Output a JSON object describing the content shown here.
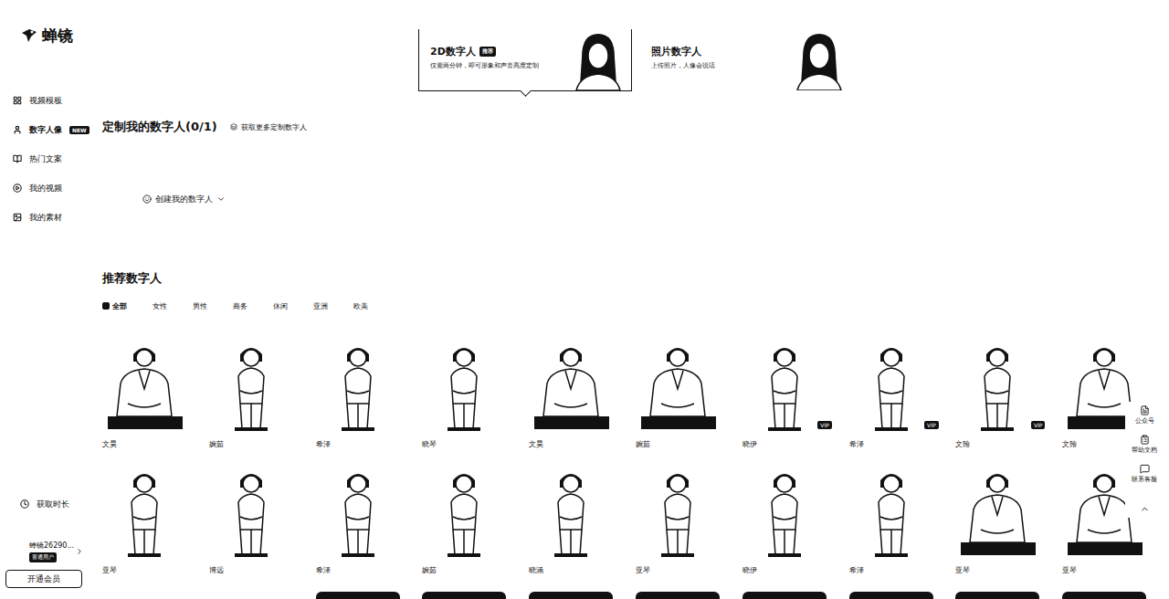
{
  "logo": {
    "text": "蝉镜"
  },
  "sidebar": {
    "items": [
      {
        "label": "视频模板",
        "selected": false,
        "badge": ""
      },
      {
        "label": "数字人像",
        "selected": true,
        "badge": "NEW"
      },
      {
        "label": "热门文案",
        "selected": false,
        "badge": ""
      },
      {
        "label": "我的视频",
        "selected": false,
        "badge": ""
      },
      {
        "label": "我的素材",
        "selected": false,
        "badge": ""
      }
    ],
    "get_time": "获取时长",
    "user": "蝉镜26290...",
    "user_tag": "普通用户",
    "button": "开通会员"
  },
  "mode_cards": [
    {
      "title": "2D数字人",
      "badge": "推荐",
      "subtitle": "仅需两分钟，即可形象和声音高度定制",
      "selected": true
    },
    {
      "title": "照片数字人",
      "badge": "",
      "subtitle": "上传照片，人像会说话",
      "selected": false
    }
  ],
  "custom": {
    "title": "定制我的数字人(0/1)",
    "more": "获取更多定制数字人",
    "create": "创建我的数字人"
  },
  "recommended": {
    "title": "推荐数字人",
    "filters": [
      {
        "label": "全部",
        "selected": true
      },
      {
        "label": "女性",
        "selected": false
      },
      {
        "label": "男性",
        "selected": false
      },
      {
        "label": "商务",
        "selected": false
      },
      {
        "label": "休闲",
        "selected": false
      },
      {
        "label": "亚洲",
        "selected": false
      },
      {
        "label": "欧美",
        "selected": false
      }
    ],
    "vip_badge": "VIP",
    "avatars": [
      {
        "name": "文昊",
        "vip": false,
        "kind": "sitting"
      },
      {
        "name": "婉茹",
        "vip": false,
        "kind": "standing"
      },
      {
        "name": "希泽",
        "vip": false,
        "kind": "standing"
      },
      {
        "name": "晓琴",
        "vip": false,
        "kind": "standing"
      },
      {
        "name": "文昊",
        "vip": false,
        "kind": "sitting"
      },
      {
        "name": "婉茹",
        "vip": false,
        "kind": "sitting"
      },
      {
        "name": "晓伊",
        "vip": true,
        "kind": "standing"
      },
      {
        "name": "希泽",
        "vip": true,
        "kind": "standing"
      },
      {
        "name": "文翰",
        "vip": true,
        "kind": "standing"
      },
      {
        "name": "文翰",
        "vip": false,
        "kind": "sitting"
      },
      {
        "name": "亚琴",
        "vip": false,
        "kind": "standing"
      },
      {
        "name": "博远",
        "vip": false,
        "kind": "standing"
      },
      {
        "name": "希泽",
        "vip": false,
        "kind": "standing"
      },
      {
        "name": "婉茹",
        "vip": false,
        "kind": "standing"
      },
      {
        "name": "晓涵",
        "vip": false,
        "kind": "standing"
      },
      {
        "name": "亚琴",
        "vip": false,
        "kind": "standing"
      },
      {
        "name": "晓伊",
        "vip": false,
        "kind": "standing"
      },
      {
        "name": "希泽",
        "vip": false,
        "kind": "standing"
      },
      {
        "name": "亚琴",
        "vip": false,
        "kind": "sitting"
      },
      {
        "name": "亚琴",
        "vip": false,
        "kind": "sitting"
      }
    ],
    "partial_row": [
      {
        "kind": "light"
      },
      {
        "kind": "light"
      },
      {
        "kind": "dark"
      },
      {
        "kind": "dark"
      },
      {
        "kind": "dark"
      },
      {
        "kind": "dark"
      },
      {
        "kind": "dark"
      },
      {
        "kind": "dark"
      },
      {
        "kind": "dark"
      },
      {
        "kind": "dark"
      }
    ]
  },
  "float_panel": [
    {
      "label": "公众号"
    },
    {
      "label": "帮助文档"
    },
    {
      "label": "联系客服"
    }
  ]
}
